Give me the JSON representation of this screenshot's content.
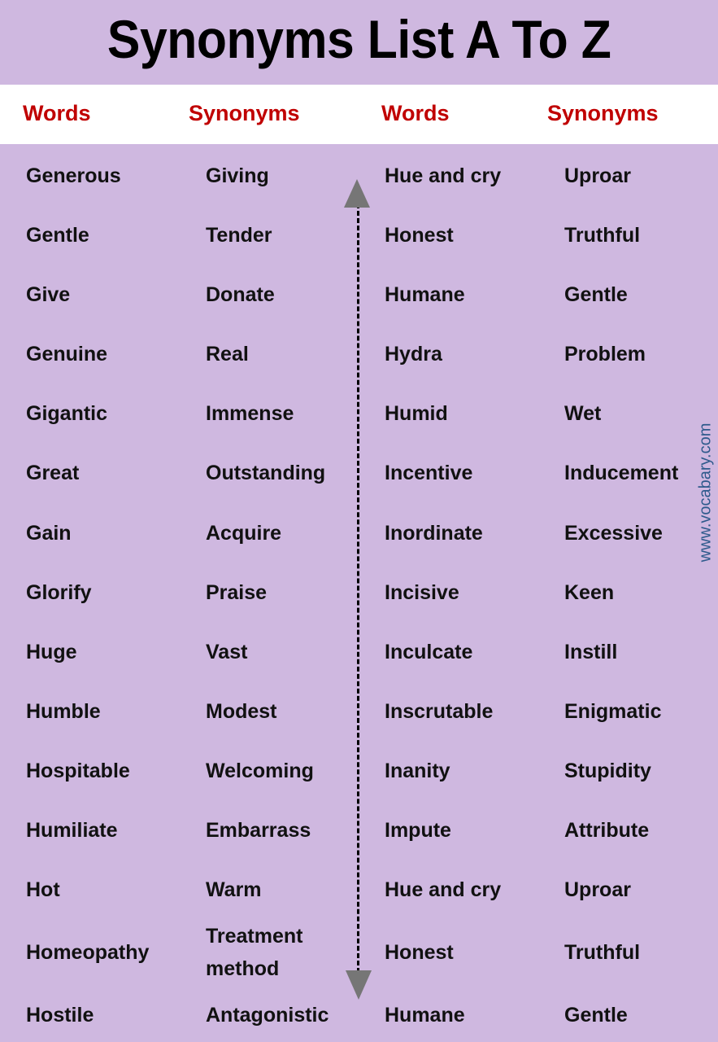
{
  "title": "Synonyms List A To Z",
  "headers": [
    "Words",
    "Synonyms",
    "Words",
    "Synonyms"
  ],
  "colors": {
    "background": "#cfb8e0",
    "header_background": "#ffffff",
    "header_text": "#c00000",
    "body_text": "#111111",
    "arrow": "#767676",
    "watermark": "#2e5a8c"
  },
  "rows": [
    {
      "word1": "Generous",
      "syn1": "Giving",
      "word2": "Hue and cry",
      "syn2": "Uproar"
    },
    {
      "word1": "Gentle",
      "syn1": "Tender",
      "word2": "Honest",
      "syn2": "Truthful"
    },
    {
      "word1": "Give",
      "syn1": "Donate",
      "word2": "Humane",
      "syn2": "Gentle"
    },
    {
      "word1": "Genuine",
      "syn1": "Real",
      "word2": "Hydra",
      "syn2": "Problem"
    },
    {
      "word1": "Gigantic",
      "syn1": "Immense",
      "word2": "Humid",
      "syn2": "Wet"
    },
    {
      "word1": "Great",
      "syn1": "Outstanding",
      "word2": "Incentive",
      "syn2": "Inducement"
    },
    {
      "word1": "Gain",
      "syn1": "Acquire",
      "word2": "Inordinate",
      "syn2": "Excessive"
    },
    {
      "word1": "Glorify",
      "syn1": "Praise",
      "word2": "Incisive",
      "syn2": "Keen"
    },
    {
      "word1": "Huge",
      "syn1": "Vast",
      "word2": "Inculcate",
      "syn2": "Instill"
    },
    {
      "word1": "Humble",
      "syn1": "Modest",
      "word2": "Inscrutable",
      "syn2": "Enigmatic"
    },
    {
      "word1": "Hospitable",
      "syn1": "Welcoming",
      "word2": "Inanity",
      "syn2": "Stupidity"
    },
    {
      "word1": "Humiliate",
      "syn1": "Embarrass",
      "word2": "Impute",
      "syn2": "Attribute"
    },
    {
      "word1": "Hot",
      "syn1": "Warm",
      "word2": "Hue and cry",
      "syn2": "Uproar"
    },
    {
      "word1": "Homeopathy",
      "syn1": "Treatment method",
      "syn1_lines": [
        "Treatment",
        "method"
      ],
      "word2": "Honest",
      "syn2": "Truthful"
    },
    {
      "word1": "Hostile",
      "syn1": "Antagonistic",
      "word2": "Humane",
      "syn2": "Gentle"
    }
  ],
  "watermark": "www.vocabary.com"
}
